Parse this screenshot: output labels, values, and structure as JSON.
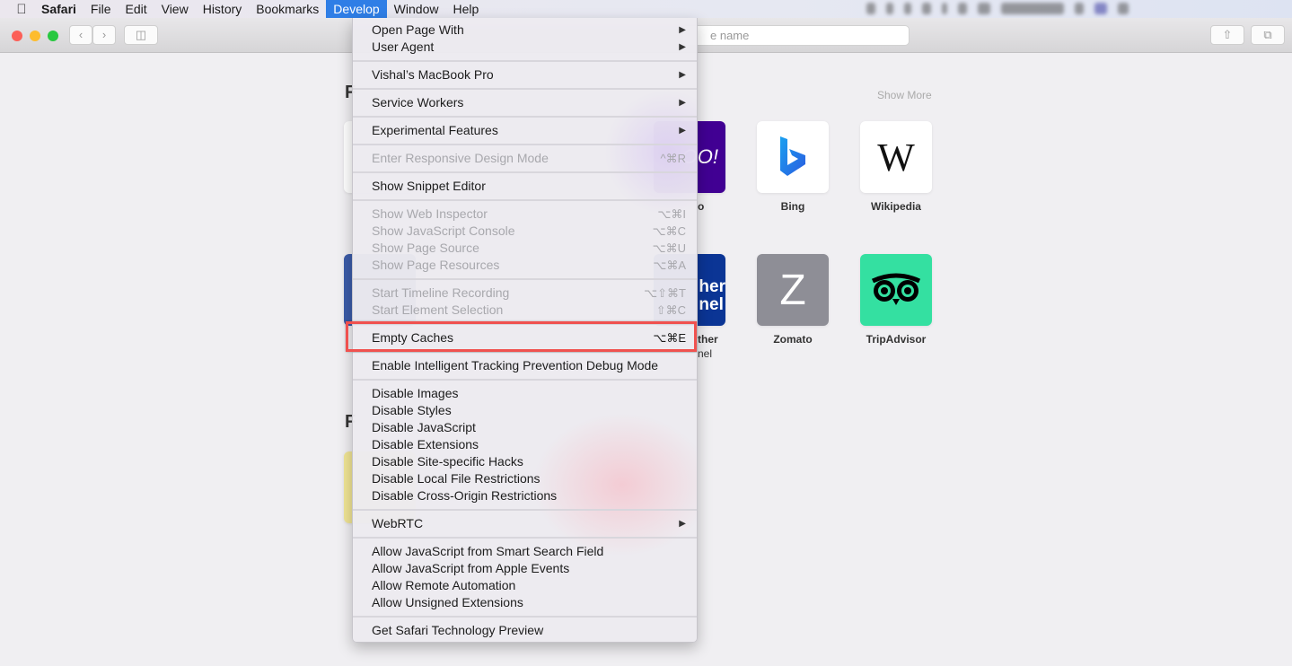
{
  "menubar": {
    "apple_icon": "apple-logo-icon",
    "items": [
      "Safari",
      "File",
      "Edit",
      "View",
      "History",
      "Bookmarks",
      "Develop",
      "Window",
      "Help"
    ],
    "active": "Develop"
  },
  "toolbar": {
    "address_placeholder_fragment": "e name",
    "icons": [
      "back-icon",
      "forward-icon",
      "sidebar-icon",
      "share-icon",
      "tabs-overview-icon"
    ]
  },
  "page": {
    "heading_fragment": "F",
    "heading_fragment_2": "F",
    "show_more": "Show More",
    "tiles": [
      {
        "logo": "OO!",
        "label": "o",
        "color": "#410093"
      },
      {
        "logo": "b",
        "label": "Bing",
        "color": "#ffffff"
      },
      {
        "logo": "W",
        "label": "Wikipedia",
        "color": "#ffffff"
      },
      {
        "logo": "her\nnel",
        "label": "ther",
        "label2": "nel",
        "color": "#0b3595"
      },
      {
        "logo": "Z",
        "label": "Zomato",
        "color": "#8e8e96"
      },
      {
        "logo": "owl",
        "label": "TripAdvisor",
        "color": "#34e0a1"
      }
    ]
  },
  "develop_menu": {
    "groups": [
      [
        {
          "label": "Open Page With",
          "submenu": true
        },
        {
          "label": "User Agent",
          "submenu": true
        }
      ],
      [
        {
          "label": "Vishal’s MacBook Pro",
          "submenu": true
        }
      ],
      [
        {
          "label": "Service Workers",
          "submenu": true
        }
      ],
      [
        {
          "label": "Experimental Features",
          "submenu": true
        }
      ],
      [
        {
          "label": "Enter Responsive Design Mode",
          "shortcut": "^⌘R",
          "disabled": true
        }
      ],
      [
        {
          "label": "Show Snippet Editor"
        }
      ],
      [
        {
          "label": "Show Web Inspector",
          "shortcut": "⌥⌘I",
          "disabled": true
        },
        {
          "label": "Show JavaScript Console",
          "shortcut": "⌥⌘C",
          "disabled": true
        },
        {
          "label": "Show Page Source",
          "shortcut": "⌥⌘U",
          "disabled": true
        },
        {
          "label": "Show Page Resources",
          "shortcut": "⌥⌘A",
          "disabled": true
        }
      ],
      [
        {
          "label": "Start Timeline Recording",
          "shortcut": "⌥⇧⌘T",
          "disabled": true
        },
        {
          "label": "Start Element Selection",
          "shortcut": "⇧⌘C",
          "disabled": true
        }
      ],
      [
        {
          "label": "Empty Caches",
          "shortcut": "⌥⌘E",
          "highlighted": true
        }
      ],
      [
        {
          "label": "Enable Intelligent Tracking Prevention Debug Mode"
        }
      ],
      [
        {
          "label": "Disable Images"
        },
        {
          "label": "Disable Styles"
        },
        {
          "label": "Disable JavaScript"
        },
        {
          "label": "Disable Extensions"
        },
        {
          "label": "Disable Site-specific Hacks"
        },
        {
          "label": "Disable Local File Restrictions"
        },
        {
          "label": "Disable Cross-Origin Restrictions"
        }
      ],
      [
        {
          "label": "WebRTC",
          "submenu": true
        }
      ],
      [
        {
          "label": "Allow JavaScript from Smart Search Field"
        },
        {
          "label": "Allow JavaScript from Apple Events"
        },
        {
          "label": "Allow Remote Automation"
        },
        {
          "label": "Allow Unsigned Extensions"
        }
      ],
      [
        {
          "label": "Get Safari Technology Preview"
        }
      ]
    ],
    "highlight_color": "#f0514f"
  }
}
